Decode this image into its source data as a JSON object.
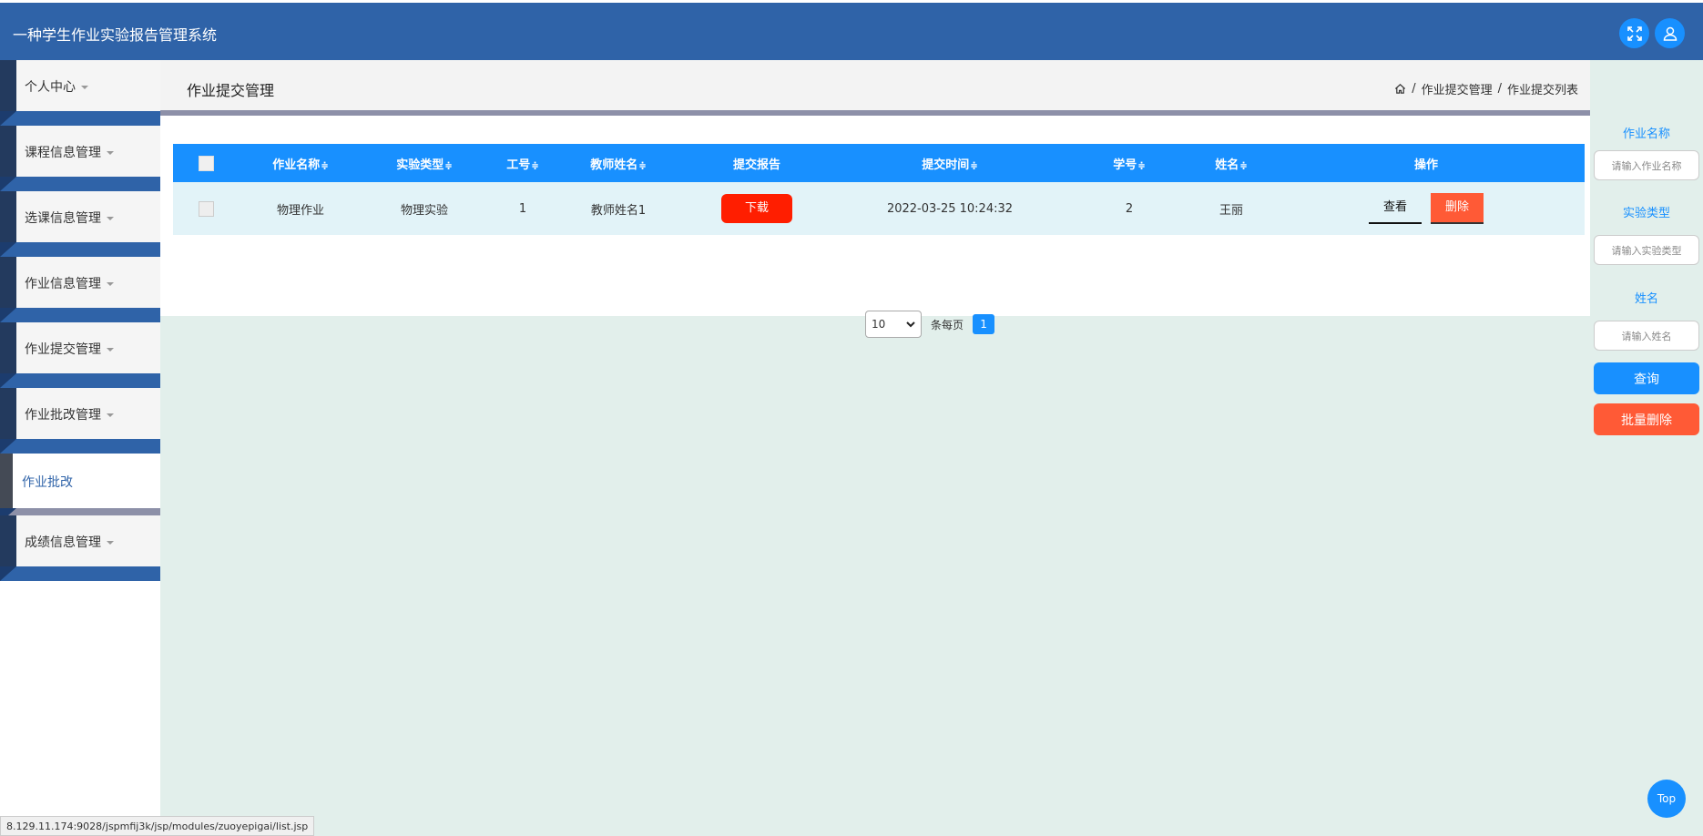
{
  "app": {
    "title": "一种学生作业实验报告管理系统"
  },
  "sidebar": {
    "items": [
      {
        "label": "个人中心"
      },
      {
        "label": "课程信息管理"
      },
      {
        "label": "选课信息管理"
      },
      {
        "label": "作业信息管理"
      },
      {
        "label": "作业提交管理"
      },
      {
        "label": "作业批改管理"
      },
      {
        "label": "作业批改"
      },
      {
        "label": "成绩信息管理"
      }
    ]
  },
  "header": {
    "page_title": "作业提交管理",
    "breadcrumb": [
      "作业提交管理",
      "作业提交列表"
    ],
    "separator": "/"
  },
  "table": {
    "columns": [
      "作业名称",
      "实验类型",
      "工号",
      "教师姓名",
      "提交报告",
      "提交时间",
      "学号",
      "姓名",
      "操作"
    ],
    "sortable_mark": "≑",
    "rows": [
      {
        "name": "物理作业",
        "type": "物理实验",
        "job_no": "1",
        "teacher": "教师姓名1",
        "report_btn": "下载",
        "time": "2022-03-25 10:24:32",
        "student_no": "2",
        "student_name": "王丽",
        "view_btn": "查看",
        "delete_btn": "删除"
      }
    ]
  },
  "pager": {
    "page_size": "10",
    "per_page_label": "条每页",
    "current_page": "1"
  },
  "search": {
    "name_label": "作业名称",
    "name_placeholder": "请输入作业名称",
    "type_label": "实验类型",
    "type_placeholder": "请输入实验类型",
    "student_label": "姓名",
    "student_placeholder": "请输入姓名",
    "query_btn": "查询",
    "batch_delete_btn": "批量删除"
  },
  "colors": {
    "primary": "#1890ff",
    "header_bg": "#2f63a8",
    "danger": "#ff1e00",
    "danger_soft": "#ff5a36"
  },
  "status_bar": "8.129.11.174:9028/jspmfij3k/jsp/modules/zuoyepigai/list.jsp",
  "back_to_top": "Top"
}
